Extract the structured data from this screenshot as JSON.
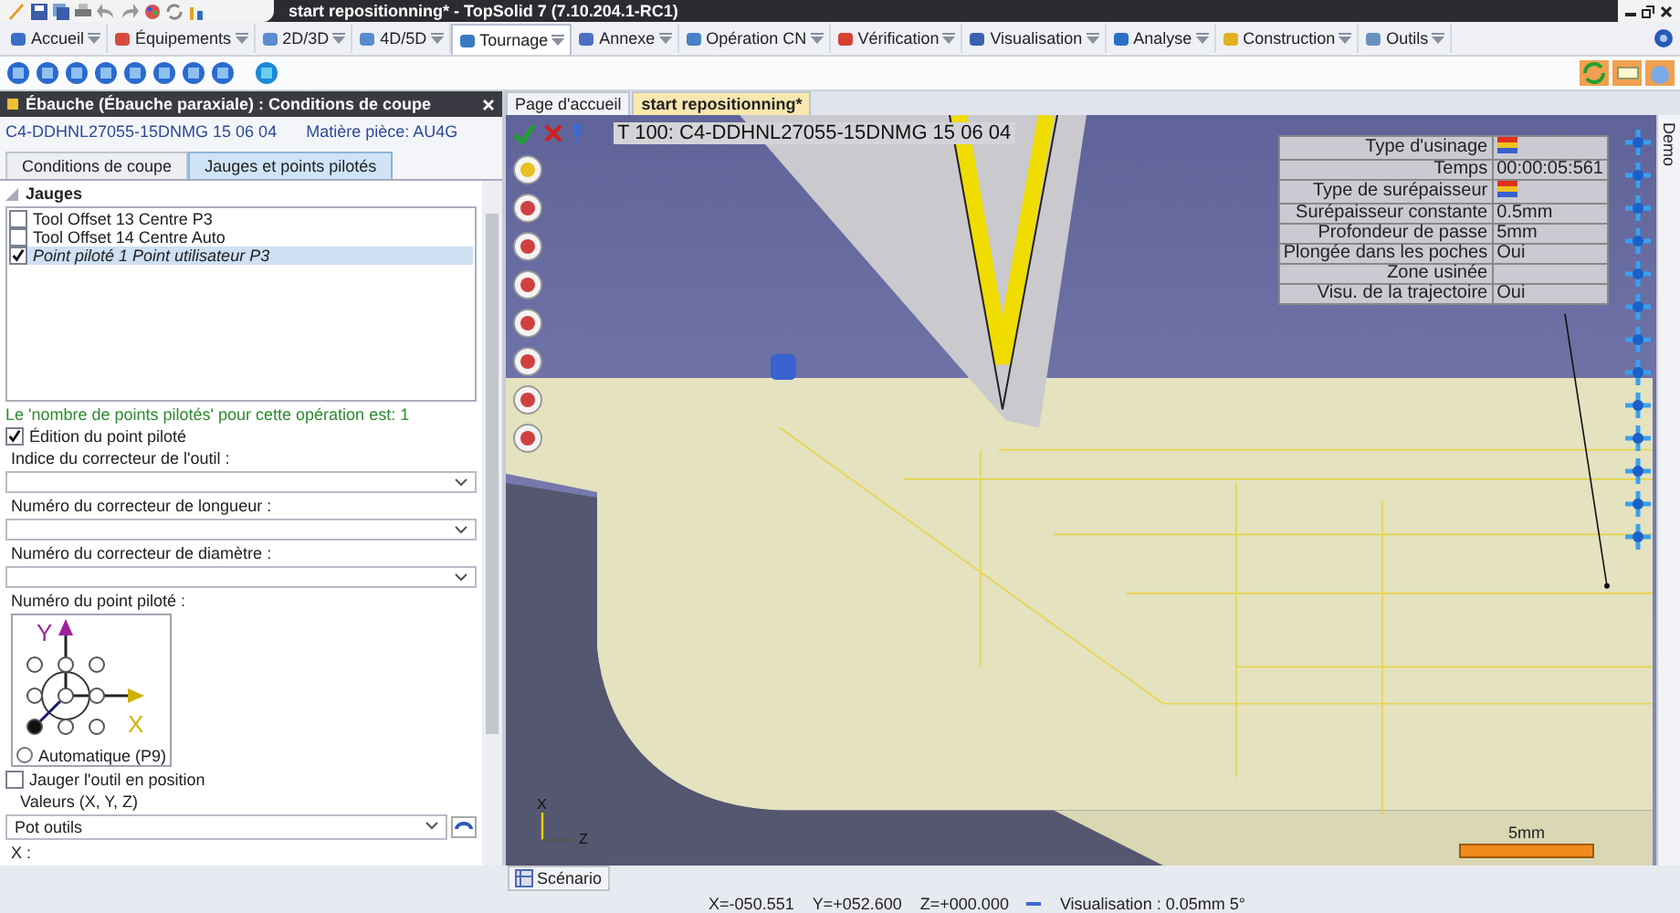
{
  "window": {
    "title": "start repositionning* - TopSolid 7 (7.10.204.1-RC1)"
  },
  "menu_tabs": [
    {
      "label": "Accueil",
      "selected": false
    },
    {
      "label": "Équipements",
      "selected": false
    },
    {
      "label": "2D/3D",
      "selected": false
    },
    {
      "label": "4D/5D",
      "selected": false
    },
    {
      "label": "Tournage",
      "selected": true
    },
    {
      "label": "Annexe",
      "selected": false
    },
    {
      "label": "Opération CN",
      "selected": false
    },
    {
      "label": "Vérification",
      "selected": false
    },
    {
      "label": "Visualisation",
      "selected": false
    },
    {
      "label": "Analyse",
      "selected": false
    },
    {
      "label": "Construction",
      "selected": false
    },
    {
      "label": "Outils",
      "selected": false
    }
  ],
  "panel": {
    "title": "Ébauche (Ébauche paraxiale) : Conditions de coupe",
    "tool": "C4-DDHNL27055-15DNMG 15 06 04",
    "material": "Matière pièce: AU4G",
    "tabs": [
      {
        "label": "Conditions de coupe",
        "selected": false
      },
      {
        "label": "Jauges et points pilotés",
        "selected": true
      }
    ],
    "section": "Jauges",
    "gauges": [
      {
        "label": "Tool Offset 13 Centre P3",
        "checked": false,
        "selected": false
      },
      {
        "label": "Tool Offset 14 Centre Auto",
        "checked": false,
        "selected": false
      },
      {
        "label": "Point piloté 1 Point utilisateur P3",
        "checked": true,
        "selected": true
      }
    ],
    "message": "Le 'nombre de points pilotés' pour cette opération est: 1",
    "edit_checkbox": {
      "label": "Édition du point piloté",
      "checked": true
    },
    "fields": [
      {
        "label": "Indice du correcteur de l'outil :"
      },
      {
        "label": "Numéro du correcteur de longueur :"
      },
      {
        "label": "Numéro du correcteur de diamètre :"
      }
    ],
    "point_label": "Numéro du point piloté :",
    "axis_y": "Y",
    "axis_x": "X",
    "auto_radio": {
      "label": "Automatique (P9)",
      "selected": false
    },
    "gauge_checkbox": {
      "label": "Jauger l'outil en position",
      "checked": false
    },
    "values_group": "Valeurs (X, Y, Z)",
    "values_combo": "Pot outils",
    "x_label": "X :"
  },
  "doc_tabs": [
    {
      "label": "Page d'accueil",
      "selected": false
    },
    {
      "label": "start repositionning*",
      "selected": true
    }
  ],
  "viewport": {
    "operation": "T 100: C4-DDHNL27055-15DNMG 15 06 04",
    "info": [
      {
        "label": "Type d'usinage",
        "kind": "icon"
      },
      {
        "label": "Temps",
        "kind": "text",
        "value": "00:00:05:561"
      },
      {
        "label": "Type de surépaisseur",
        "kind": "icon"
      },
      {
        "label": "Surépaisseur constante",
        "kind": "text",
        "value": "0.5mm"
      },
      {
        "label": "Profondeur de passe",
        "kind": "text",
        "value": "5mm"
      },
      {
        "label": "Plongée dans les poches",
        "kind": "text",
        "value": "Oui"
      },
      {
        "label": "Zone usinée",
        "kind": "empty"
      },
      {
        "label": "Visu. de la trajectoire",
        "kind": "text",
        "value": "Oui"
      }
    ],
    "scale": "5mm",
    "triad_x": "X",
    "triad_z": "Z",
    "side_tab": "Demo"
  },
  "bottom_tab": "Scénario",
  "status_bar": {
    "x": "X=-050.551",
    "y": "Y=+052.600",
    "z": "Z=+000.000",
    "display": "Visualisation : 0.05mm 5°"
  }
}
